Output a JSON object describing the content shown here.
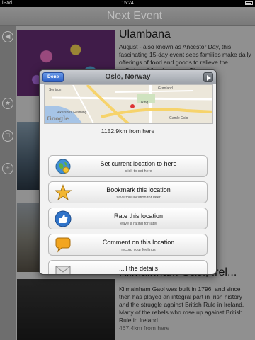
{
  "status": {
    "carrier": "iPad",
    "time": "15:24"
  },
  "header": {
    "title": "Next Event"
  },
  "sidebar": {
    "icons": [
      "back-icon",
      "star-icon",
      "trash-icon",
      "add-icon"
    ]
  },
  "entries": [
    {
      "title": "Ulambana",
      "text": "August - also known as Ancestor Day, this fascinating 15-day event sees families make daily offerings of food and goods to relieve the suffering of the deceased. They go",
      "distance": ""
    },
    {
      "title": "",
      "text": "the 100- ...islands ...any of them ...ill take ...forests",
      "distance": ""
    },
    {
      "title": "",
      "text": "...argest city, ...2000 years ...cination ...relieve ...history",
      "distance": ""
    },
    {
      "title": "Kilmainham Gaol, Irel...",
      "text": "Kilmainham Gaol was built in 1796, and since then has played an integral part in Irish history and the struggle against British Rule in Ireland. Many of the rebels who rose up against British Rule in Ireland",
      "distance": "467.4km from here"
    }
  ],
  "popup": {
    "done_label": "Done",
    "title": "Oslo, Norway",
    "map": {
      "labels": [
        "Sentrum",
        "Akershus Festning",
        "Grønland",
        "Ring1",
        "Gamle Oslo"
      ],
      "attribution": "Google"
    },
    "distance": "1152.9km from here",
    "buttons": [
      {
        "label": "Set current location to here",
        "sub": "click to set here",
        "icon": "globe-icon"
      },
      {
        "label": "Bookmark this location",
        "sub": "save this location for later",
        "icon": "star-icon"
      },
      {
        "label": "Rate this location",
        "sub": "leave a rating for later",
        "icon": "thumbs-up-icon"
      },
      {
        "label": "Comment on this location",
        "sub": "record your feelings",
        "icon": "speech-bubble-icon"
      },
      {
        "label": "...ll the details",
        "sub": "",
        "icon": "mail-icon"
      }
    ]
  }
}
